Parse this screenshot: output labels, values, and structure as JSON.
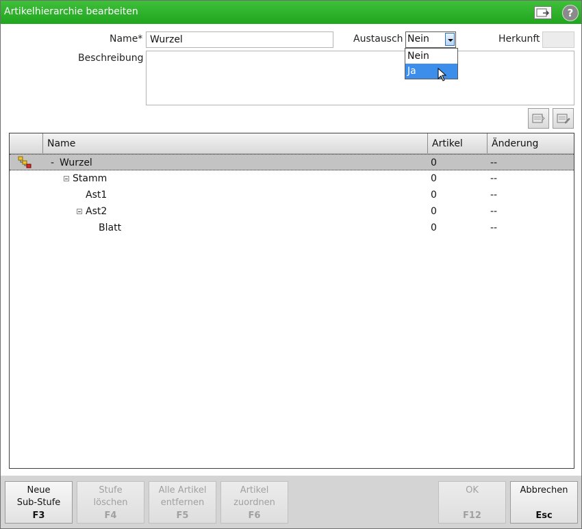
{
  "window": {
    "title": "Artikelhierarchie bearbeiten",
    "help_glyph": "?"
  },
  "form": {
    "name_label": "Name*",
    "name_value": "Wurzel",
    "austausch_label": "Austausch",
    "austausch_value": "Nein",
    "austausch_options": [
      "Nein",
      "Ja"
    ],
    "austausch_highlighted": "Ja",
    "herkunft_label": "Herkunft",
    "herkunft_value": "",
    "beschreibung_label": "Beschreibung",
    "beschreibung_value": ""
  },
  "grid": {
    "columns": [
      "Name",
      "Artikel",
      "Änderung"
    ],
    "rows": [
      {
        "toggle": "-",
        "name": "Wurzel",
        "level": 0,
        "artikel": "0",
        "aenderung": "--",
        "selected": true
      },
      {
        "toggle": "⊟",
        "name": "Stamm",
        "level": 1,
        "artikel": "0",
        "aenderung": "--"
      },
      {
        "toggle": "",
        "name": "Ast1",
        "level": 2,
        "artikel": "0",
        "aenderung": "--"
      },
      {
        "toggle": "⊟",
        "name": "Ast2",
        "level": 2,
        "artikel": "0",
        "aenderung": "--"
      },
      {
        "toggle": "",
        "name": "Blatt",
        "level": 3,
        "artikel": "0",
        "aenderung": "--"
      }
    ]
  },
  "footer": {
    "buttons": [
      {
        "line1": "Neue",
        "line2": "Sub-Stufe",
        "key": "F3",
        "enabled": true
      },
      {
        "line1": "Stufe",
        "line2": "löschen",
        "key": "F4",
        "enabled": false
      },
      {
        "line1": "Alle Artikel",
        "line2": "entfernen",
        "key": "F5",
        "enabled": false
      },
      {
        "line1": "Artikel",
        "line2": "zuordnen",
        "key": "F6",
        "enabled": false
      },
      {
        "line1": "OK",
        "line2": "",
        "key": "F12",
        "enabled": false
      },
      {
        "line1": "Abbrechen",
        "line2": "",
        "key": "Esc",
        "enabled": true
      }
    ]
  },
  "colors": {
    "titlebar": "#2bb02a",
    "selection": "#3d8eea",
    "row_selected": "#c3c3c3"
  }
}
